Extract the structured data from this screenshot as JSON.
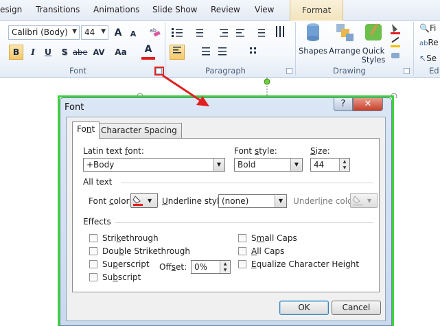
{
  "ribbon_tabs": [
    "esign",
    "Transitions",
    "Animations",
    "Slide Show",
    "Review",
    "View",
    "Format"
  ],
  "font_group": {
    "font_name": "Calibri (Body)",
    "font_size": "44",
    "label": "Font",
    "buttons": {
      "bold": "B",
      "italic": "I",
      "underline": "U",
      "shadow": "S",
      "strike": "abe",
      "spacing": "AV",
      "case": "Aa",
      "color": "A",
      "grow": "A",
      "shrink": "A"
    }
  },
  "paragraph_group": {
    "label": "Paragraph"
  },
  "drawing_group": {
    "label": "Drawing",
    "shapes": "Shapes",
    "arrange": "Arrange",
    "quick_styles_1": "Quick",
    "quick_styles_2": "Styles"
  },
  "editing_group": {
    "label": "Ed",
    "find": "Fi",
    "replace": "Re",
    "select": "Se"
  },
  "dialog": {
    "title": "Font",
    "help": "?",
    "close": "✕",
    "tabs": {
      "font_pre": "Fo",
      "font_u": "n",
      "font_post": "t",
      "spacing": "Character Spacing"
    },
    "latin_font_label_pre": "Latin text ",
    "latin_font_label_u": "f",
    "latin_font_label_post": "ont:",
    "latin_font_value": "+Body",
    "font_style_label_pre": "Font ",
    "font_style_label_u": "s",
    "font_style_label_post": "tyle:",
    "font_style_value": "Bold",
    "size_label_pre": "",
    "size_label_u": "S",
    "size_label_post": "ize:",
    "size_value": "44",
    "all_text": "All text",
    "font_color_label_pre": "Font ",
    "font_color_label_u": "c",
    "font_color_label_post": "olor",
    "underline_style_label_pre": "",
    "underline_style_label_u": "U",
    "underline_style_label_post": "nderline style",
    "underline_style_value": "(none)",
    "underline_color_label_pre": "Underl",
    "underline_color_label_u": "i",
    "underline_color_label_post": "ne color",
    "effects": "Effects",
    "strikethrough": {
      "pre": "Stri",
      "u": "k",
      "post": "ethrough"
    },
    "double_strikethrough": {
      "pre": "Dou",
      "u": "b",
      "post": "le Strikethrough"
    },
    "superscript": {
      "pre": "Su",
      "u": "p",
      "post": "erscript"
    },
    "subscript": {
      "pre": "Su",
      "u": "b",
      "post": "script"
    },
    "offset": {
      "pre": "Off",
      "u": "s",
      "post": "et:"
    },
    "offset_value": "0%",
    "small_caps": {
      "pre": "S",
      "u": "m",
      "post": "all Caps"
    },
    "all_caps": {
      "pre": "",
      "u": "A",
      "post": "ll Caps"
    },
    "equalize": {
      "pre": "",
      "u": "E",
      "post": "qualize Character Height"
    },
    "ok": "OK",
    "cancel": "Cancel"
  },
  "colors": {
    "accent_green": "#3dd23d",
    "callout_red": "#e02020",
    "font_color_red": "#e02020"
  }
}
